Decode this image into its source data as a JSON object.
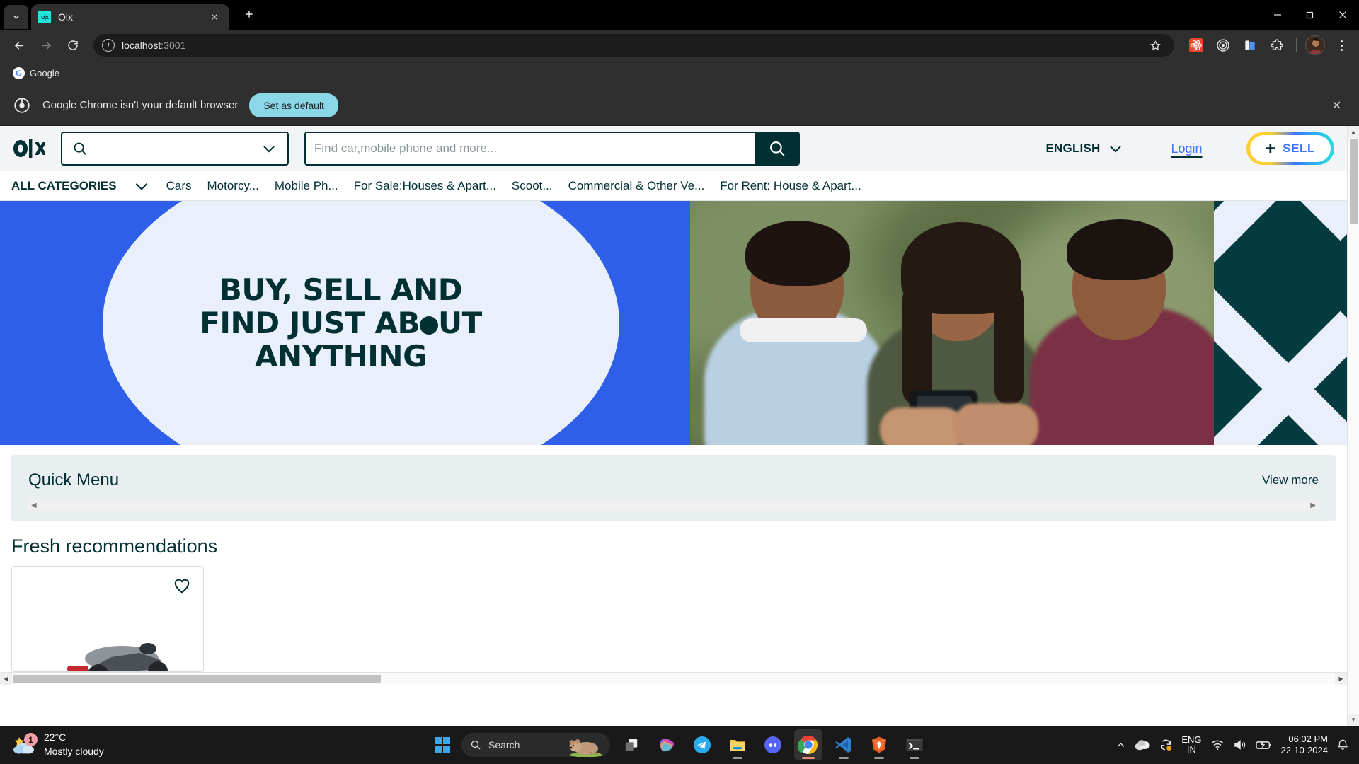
{
  "browser": {
    "tab": {
      "title": "Olx",
      "favicon_label": "olx",
      "close_icon": "close-icon"
    },
    "new_tab_tooltip": "New tab",
    "url": {
      "host": "localhost",
      "port": ":3001"
    },
    "window_controls": {
      "minimize": "—",
      "maximize": "❐",
      "close": "✕"
    },
    "bookmarks": [
      {
        "label": "Google",
        "icon": "google-icon"
      }
    ],
    "infobar": {
      "message": "Google Chrome isn't your default browser",
      "button": "Set as default",
      "close": "✕"
    },
    "toolbar_icons": [
      "react-devtools-icon",
      "target-icon",
      "card-icon",
      "extensions-icon"
    ]
  },
  "site": {
    "logo": "olx-logo",
    "location": {
      "placeholder": "",
      "value": ""
    },
    "search": {
      "placeholder": "Find car,mobile phone and more...",
      "value": ""
    },
    "language": "ENGLISH",
    "login": "Login",
    "sell": {
      "plus": "+",
      "label": "SELL"
    },
    "categories": {
      "all_label": "ALL CATEGORIES",
      "items": [
        "Cars",
        "Motorcy...",
        "Mobile Ph...",
        "For Sale:Houses & Apart...",
        "Scoot...",
        "Commercial & Other Ve...",
        "For Rent: House & Apart..."
      ]
    },
    "hero": {
      "line1": "BUY, SELL AND",
      "line2a": "FIND JUST AB",
      "line2b": "UT",
      "line3": "ANYTHING"
    },
    "quick_menu": {
      "title": "Quick Menu",
      "view_more": "View more"
    },
    "fresh": {
      "title": "Fresh recommendations"
    }
  },
  "taskbar": {
    "weather": {
      "temp": "22°C",
      "condition": "Mostly cloudy",
      "badge": "1"
    },
    "search_placeholder": "Search",
    "apps": [
      {
        "name": "copilot",
        "active": false
      },
      {
        "name": "telegram",
        "active": false
      },
      {
        "name": "file-explorer",
        "active": false
      },
      {
        "name": "discord",
        "active": false
      },
      {
        "name": "chrome",
        "active": true
      },
      {
        "name": "vscode",
        "active": false
      },
      {
        "name": "brave",
        "active": false
      },
      {
        "name": "terminal",
        "active": false
      }
    ],
    "tray": {
      "language_line1": "ENG",
      "language_line2": "IN",
      "time": "06:02 PM",
      "date": "22-10-2024"
    }
  },
  "colors": {
    "olx_dark": "#002f34",
    "olx_blue": "#3a77ff",
    "banner_blue": "#2f5fe8",
    "banner_light": "#e9f0fb",
    "accent_cyan": "#23e5db",
    "accent_yellow": "#ffce32"
  }
}
